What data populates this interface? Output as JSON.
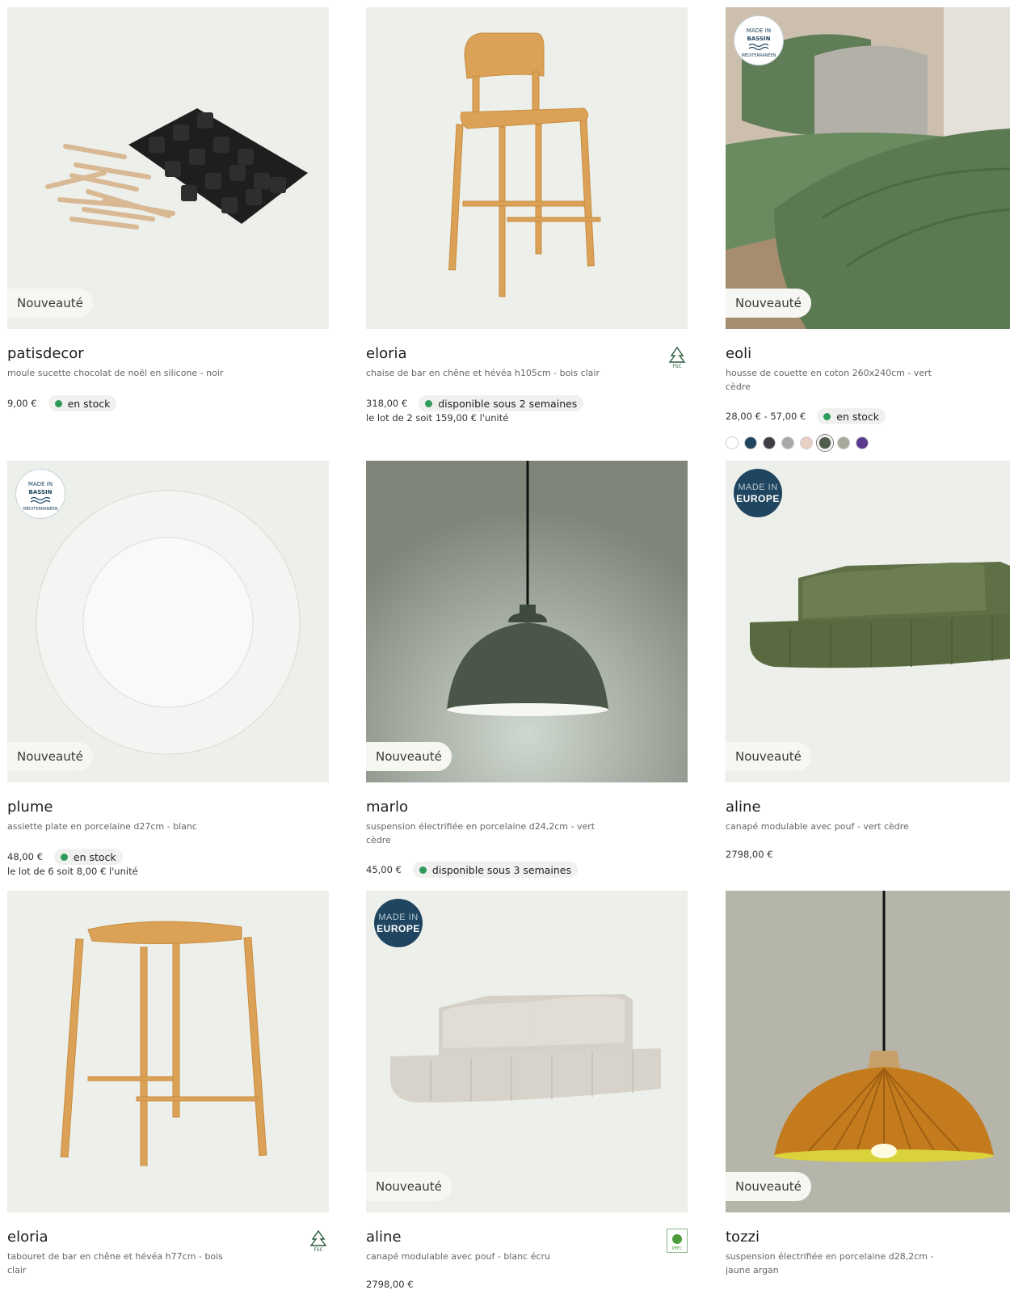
{
  "new_badge": "Nouveauté",
  "made_in_mediterranean": {
    "line1": "MADE IN",
    "line2": "BASSIN",
    "line3": "MÉDITERRANÉEN"
  },
  "made_in_europe": {
    "line1": "MADE IN",
    "line2": "EUROPE"
  },
  "colors": {
    "accent_green": "#2e9a5c",
    "europe_badge": "#1f4560",
    "image_bg": "#edefea"
  },
  "products": [
    {
      "name": "patisdecor",
      "description": "moule sucette chocolat de noël en silicone - noir",
      "price": "9,00 €",
      "stock": "en stock",
      "lot": "",
      "label": "Nouveauté",
      "made_in": "",
      "cert": ""
    },
    {
      "name": "eloria",
      "description": "chaise de bar en chêne et hévéa h105cm - bois clair",
      "price": "318,00 €",
      "stock": "disponible sous 2 semaines",
      "lot": "le lot de 2 soit 159,00 € l'unité",
      "label": "",
      "made_in": "",
      "cert": "FSC"
    },
    {
      "name": "eoli",
      "description": "housse de couette en coton 260x240cm - vert cèdre",
      "price": "28,00 € - 57,00 €",
      "stock": "en stock",
      "lot": "",
      "label": "Nouveauté",
      "made_in": "bassin",
      "cert": "",
      "swatches": [
        "#ffffff",
        "#1f4560",
        "#3d3f44",
        "#a8a8a8",
        "#e8cfc4",
        "#4f5d4a",
        "#a5a89a",
        "#5a3a8c"
      ]
    },
    {
      "name": "plume",
      "description": "assiette plate en porcelaine d27cm - blanc",
      "price": "48,00 €",
      "stock": "en stock",
      "lot": "le lot de 6 soit 8,00 € l'unité",
      "label": "Nouveauté",
      "made_in": "bassin",
      "cert": ""
    },
    {
      "name": "marlo",
      "description": "suspension électrifiée en porcelaine d24,2cm - vert cèdre",
      "price": "45,00 €",
      "stock": "disponible sous 3 semaines",
      "lot": "",
      "label": "Nouveauté",
      "made_in": "",
      "cert": ""
    },
    {
      "name": "aline",
      "description": "canapé modulable avec pouf - vert cèdre",
      "price": "2798,00 €",
      "stock": "",
      "lot": "",
      "label": "Nouveauté",
      "made_in": "europe",
      "cert": ""
    },
    {
      "name": "eloria",
      "description": "tabouret de bar en chêne et hévéa h77cm - bois clair",
      "price": "",
      "stock": "",
      "lot": "",
      "label": "",
      "made_in": "",
      "cert": "FSC"
    },
    {
      "name": "aline",
      "description": "canapé modulable avec pouf - blanc écru",
      "price": "2798,00 €",
      "stock": "",
      "lot": "",
      "label": "Nouveauté",
      "made_in": "europe",
      "cert": "PEFC"
    },
    {
      "name": "tozzi",
      "description": "suspension électrifiée en porcelaine d28,2cm - jaune argan",
      "price": "",
      "stock": "",
      "lot": "",
      "label": "Nouveauté",
      "made_in": "",
      "cert": ""
    }
  ]
}
